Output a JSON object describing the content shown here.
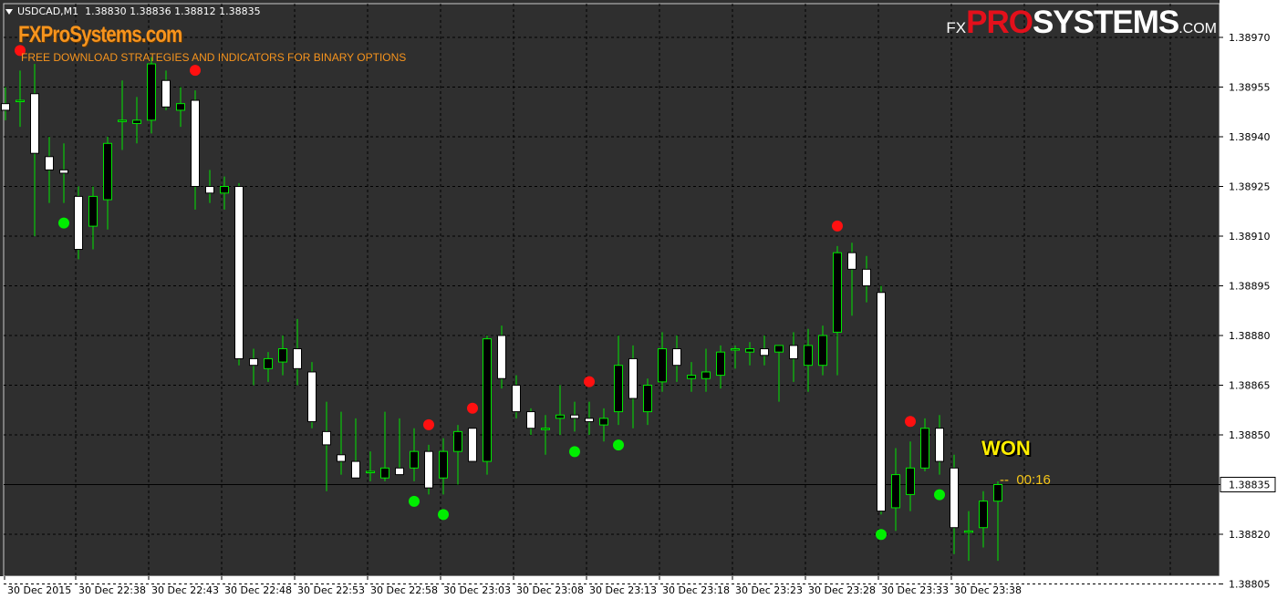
{
  "header": {
    "symbol": "USDCAD,M1",
    "ohlc": "1.38830 1.38836 1.38812 1.38835"
  },
  "brand": {
    "site": "FXProSystems.com",
    "tagline": "FREE DOWNLOAD STRATEGIES AND INDICATORS FOR BINARY OPTIONS",
    "logo_fx": "FX",
    "logo_pro": "PRO",
    "logo_systems": "SYSTEMS",
    "logo_com": ".COM"
  },
  "signal": {
    "result": "WON",
    "timer": "--  00:16"
  },
  "colors": {
    "background": "#2f2f2f",
    "grid": "#000000",
    "bull_candle_outline": "#00e600",
    "bear_candle_body": "#ffffff",
    "wick": "#00e600",
    "buy_dot": "#00ee00",
    "sell_dot": "#ff1010",
    "price_line": "#000000",
    "brand_orange": "#f7941d",
    "won_yellow": "#ffee00"
  },
  "chart_data": {
    "type": "candlestick",
    "symbol": "USDCAD",
    "timeframe": "M1",
    "current_price": 1.38835,
    "current_price_label": "1.38835",
    "y_ticks": [
      "1.38970",
      "1.38955",
      "1.38940",
      "1.38925",
      "1.38910",
      "1.38895",
      "1.38880",
      "1.38865",
      "1.38850",
      "1.38835",
      "1.38820",
      "1.38805"
    ],
    "x_ticks": [
      "30 Dec 2015",
      "30 Dec 22:38",
      "30 Dec 22:43",
      "30 Dec 22:48",
      "30 Dec 22:53",
      "30 Dec 22:58",
      "30 Dec 23:03",
      "30 Dec 23:08",
      "30 Dec 23:13",
      "30 Dec 23:18",
      "30 Dec 23:23",
      "30 Dec 23:28",
      "30 Dec 23:33",
      "30 Dec 23:38"
    ],
    "candles": [
      {
        "o": 1.3895,
        "h": 1.38955,
        "l": 1.38945,
        "c": 1.38948
      },
      {
        "o": 1.38951,
        "h": 1.3896,
        "l": 1.38943,
        "c": 1.38951
      },
      {
        "o": 1.38953,
        "h": 1.38962,
        "l": 1.3891,
        "c": 1.38935
      },
      {
        "o": 1.38934,
        "h": 1.3894,
        "l": 1.3892,
        "c": 1.3893
      },
      {
        "o": 1.3893,
        "h": 1.38938,
        "l": 1.3892,
        "c": 1.38929
      },
      {
        "o": 1.38922,
        "h": 1.38925,
        "l": 1.38903,
        "c": 1.38906
      },
      {
        "o": 1.38913,
        "h": 1.38925,
        "l": 1.38906,
        "c": 1.38922
      },
      {
        "o": 1.38921,
        "h": 1.3894,
        "l": 1.38912,
        "c": 1.38938
      },
      {
        "o": 1.38945,
        "h": 1.38957,
        "l": 1.38936,
        "c": 1.38945
      },
      {
        "o": 1.38944,
        "h": 1.38952,
        "l": 1.38938,
        "c": 1.38945
      },
      {
        "o": 1.38945,
        "h": 1.38964,
        "l": 1.38941,
        "c": 1.38962
      },
      {
        "o": 1.38957,
        "h": 1.3896,
        "l": 1.38948,
        "c": 1.38949
      },
      {
        "o": 1.38948,
        "h": 1.38955,
        "l": 1.38943,
        "c": 1.3895
      },
      {
        "o": 1.38951,
        "h": 1.38954,
        "l": 1.38918,
        "c": 1.38925
      },
      {
        "o": 1.38925,
        "h": 1.3893,
        "l": 1.3892,
        "c": 1.38923
      },
      {
        "o": 1.38923,
        "h": 1.38928,
        "l": 1.38918,
        "c": 1.38925
      },
      {
        "o": 1.38925,
        "h": 1.38926,
        "l": 1.38871,
        "c": 1.38873
      },
      {
        "o": 1.38873,
        "h": 1.38876,
        "l": 1.38865,
        "c": 1.38871
      },
      {
        "o": 1.3887,
        "h": 1.38875,
        "l": 1.38866,
        "c": 1.38873
      },
      {
        "o": 1.38872,
        "h": 1.3888,
        "l": 1.38868,
        "c": 1.38876
      },
      {
        "o": 1.38876,
        "h": 1.38885,
        "l": 1.38865,
        "c": 1.3887
      },
      {
        "o": 1.38869,
        "h": 1.38872,
        "l": 1.38852,
        "c": 1.38854
      },
      {
        "o": 1.38851,
        "h": 1.3886,
        "l": 1.38833,
        "c": 1.38847
      },
      {
        "o": 1.38844,
        "h": 1.38857,
        "l": 1.38838,
        "c": 1.38842
      },
      {
        "o": 1.38842,
        "h": 1.38855,
        "l": 1.38837,
        "c": 1.38837
      },
      {
        "o": 1.38839,
        "h": 1.38845,
        "l": 1.38836,
        "c": 1.38839
      },
      {
        "o": 1.38837,
        "h": 1.38857,
        "l": 1.38836,
        "c": 1.3884
      },
      {
        "o": 1.3884,
        "h": 1.38855,
        "l": 1.38838,
        "c": 1.38838
      },
      {
        "o": 1.3884,
        "h": 1.38852,
        "l": 1.38836,
        "c": 1.38845
      },
      {
        "o": 1.38845,
        "h": 1.38847,
        "l": 1.38832,
        "c": 1.38834
      },
      {
        "o": 1.38837,
        "h": 1.38849,
        "l": 1.38832,
        "c": 1.38845
      },
      {
        "o": 1.38845,
        "h": 1.38853,
        "l": 1.38835,
        "c": 1.38851
      },
      {
        "o": 1.38852,
        "h": 1.38852,
        "l": 1.38843,
        "c": 1.38842
      },
      {
        "o": 1.38842,
        "h": 1.3888,
        "l": 1.38838,
        "c": 1.38879
      },
      {
        "o": 1.3888,
        "h": 1.38883,
        "l": 1.38864,
        "c": 1.38867
      },
      {
        "o": 1.38865,
        "h": 1.38868,
        "l": 1.38855,
        "c": 1.38857
      },
      {
        "o": 1.38857,
        "h": 1.38858,
        "l": 1.3885,
        "c": 1.38852
      },
      {
        "o": 1.38852,
        "h": 1.38856,
        "l": 1.38844,
        "c": 1.38852
      },
      {
        "o": 1.38855,
        "h": 1.38865,
        "l": 1.3885,
        "c": 1.38856
      },
      {
        "o": 1.38856,
        "h": 1.3886,
        "l": 1.38851,
        "c": 1.38855
      },
      {
        "o": 1.38855,
        "h": 1.3886,
        "l": 1.3885,
        "c": 1.38854
      },
      {
        "o": 1.38853,
        "h": 1.38858,
        "l": 1.38848,
        "c": 1.38855
      },
      {
        "o": 1.38857,
        "h": 1.3888,
        "l": 1.38853,
        "c": 1.38871
      },
      {
        "o": 1.38873,
        "h": 1.38877,
        "l": 1.38852,
        "c": 1.38861
      },
      {
        "o": 1.38857,
        "h": 1.38867,
        "l": 1.38853,
        "c": 1.38865
      },
      {
        "o": 1.38866,
        "h": 1.38881,
        "l": 1.38863,
        "c": 1.38876
      },
      {
        "o": 1.38876,
        "h": 1.3888,
        "l": 1.38866,
        "c": 1.38871
      },
      {
        "o": 1.38867,
        "h": 1.38872,
        "l": 1.38863,
        "c": 1.38868
      },
      {
        "o": 1.38867,
        "h": 1.38876,
        "l": 1.38863,
        "c": 1.38869
      },
      {
        "o": 1.38868,
        "h": 1.38877,
        "l": 1.38864,
        "c": 1.38875
      },
      {
        "o": 1.38876,
        "h": 1.38877,
        "l": 1.3887,
        "c": 1.38876
      },
      {
        "o": 1.38875,
        "h": 1.38878,
        "l": 1.38871,
        "c": 1.38876
      },
      {
        "o": 1.38876,
        "h": 1.3888,
        "l": 1.38871,
        "c": 1.38874
      },
      {
        "o": 1.38875,
        "h": 1.38877,
        "l": 1.3886,
        "c": 1.38877
      },
      {
        "o": 1.38877,
        "h": 1.38881,
        "l": 1.38866,
        "c": 1.38873
      },
      {
        "o": 1.38871,
        "h": 1.38882,
        "l": 1.38863,
        "c": 1.38877
      },
      {
        "o": 1.38871,
        "h": 1.38883,
        "l": 1.38868,
        "c": 1.3888
      },
      {
        "o": 1.38881,
        "h": 1.38907,
        "l": 1.38868,
        "c": 1.38905
      },
      {
        "o": 1.38905,
        "h": 1.38908,
        "l": 1.38886,
        "c": 1.389
      },
      {
        "o": 1.389,
        "h": 1.38904,
        "l": 1.3889,
        "c": 1.38895
      },
      {
        "o": 1.38893,
        "h": 1.38895,
        "l": 1.38826,
        "c": 1.38827
      },
      {
        "o": 1.38828,
        "h": 1.38846,
        "l": 1.38821,
        "c": 1.38838
      },
      {
        "o": 1.38832,
        "h": 1.38848,
        "l": 1.38827,
        "c": 1.3884
      },
      {
        "o": 1.3884,
        "h": 1.38855,
        "l": 1.38839,
        "c": 1.38852
      },
      {
        "o": 1.38852,
        "h": 1.38856,
        "l": 1.38838,
        "c": 1.38842
      },
      {
        "o": 1.3884,
        "h": 1.38844,
        "l": 1.38814,
        "c": 1.38822
      },
      {
        "o": 1.38821,
        "h": 1.38827,
        "l": 1.38812,
        "c": 1.38821
      },
      {
        "o": 1.38822,
        "h": 1.38833,
        "l": 1.38816,
        "c": 1.3883
      },
      {
        "o": 1.3883,
        "h": 1.38836,
        "l": 1.38812,
        "c": 1.38835
      }
    ],
    "sell_signals": [
      1,
      13,
      29,
      32,
      40,
      57,
      62
    ],
    "buy_signals": [
      4,
      28,
      30,
      39,
      42,
      60,
      64
    ]
  }
}
